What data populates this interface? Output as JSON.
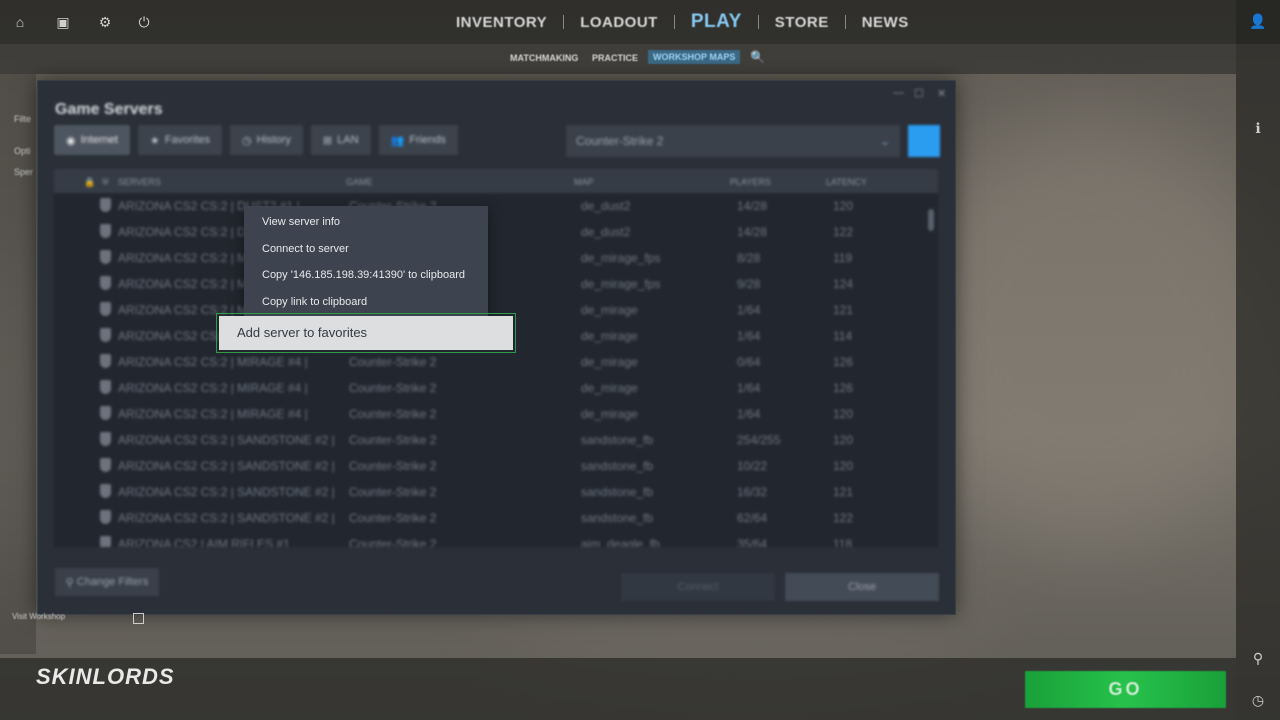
{
  "topnav": {
    "items": [
      "INVENTORY",
      "LOADOUT",
      "PLAY",
      "STORE",
      "NEWS"
    ],
    "active": "PLAY"
  },
  "subnav": {
    "items": [
      "MATCHMAKING",
      "PRACTICE",
      "WORKSHOP MAPS"
    ],
    "active": "WORKSHOP MAPS"
  },
  "left_panel": {
    "line1": "Filte",
    "line2": "Opti",
    "line3": "Sper"
  },
  "dialog": {
    "title": "Game Servers",
    "tabs": [
      "Internet",
      "Favorites",
      "History",
      "LAN",
      "Friends"
    ],
    "game_select": "Counter-Strike 2",
    "columns": [
      "SERVERS",
      "GAME",
      "MAP",
      "PLAYERS",
      "LATENCY"
    ],
    "rows": [
      {
        "server": "ARIZONA CS2 CS:2 | DUST2 #1 |",
        "game": "Counter-Strike 2",
        "map": "de_dust2",
        "players": "14/28",
        "latency": "120"
      },
      {
        "server": "ARIZONA CS2 CS:2 | DUST2 #2 |",
        "game": "Counter-Strike 2",
        "map": "de_dust2",
        "players": "14/28",
        "latency": "122"
      },
      {
        "server": "ARIZONA CS2 CS:2 | MIRAGE #1 |",
        "game": "Counter-Strike 2",
        "map": "de_mirage_fps",
        "players": "8/28",
        "latency": "119"
      },
      {
        "server": "ARIZONA CS2 CS:2 | MIRAGE #2 |",
        "game": "Counter-Strike 2",
        "map": "de_mirage_fps",
        "players": "9/28",
        "latency": "124"
      },
      {
        "server": "ARIZONA CS2 CS:2 | MIRAGE #3 |",
        "game": "Counter-Strike 2",
        "map": "de_mirage",
        "players": "1/64",
        "latency": "121"
      },
      {
        "server": "ARIZONA CS2 CS:2 | MIRAGE #4 |",
        "game": "Counter-Strike 2",
        "map": "de_mirage",
        "players": "1/64",
        "latency": "114"
      },
      {
        "server": "ARIZONA CS2 CS:2 | MIRAGE #4 |",
        "game": "Counter-Strike 2",
        "map": "de_mirage",
        "players": "0/64",
        "latency": "126"
      },
      {
        "server": "ARIZONA CS2 CS:2 | MIRAGE #4 |",
        "game": "Counter-Strike 2",
        "map": "de_mirage",
        "players": "1/64",
        "latency": "126"
      },
      {
        "server": "ARIZONA CS2 CS:2 | MIRAGE #4 |",
        "game": "Counter-Strike 2",
        "map": "de_mirage",
        "players": "1/64",
        "latency": "120"
      },
      {
        "server": "ARIZONA CS2 CS:2 | SANDSTONE #2 |",
        "game": "Counter-Strike 2",
        "map": "sandstone_fb",
        "players": "254/255",
        "latency": "120"
      },
      {
        "server": "ARIZONA CS2 CS:2 | SANDSTONE #2 |",
        "game": "Counter-Strike 2",
        "map": "sandstone_fb",
        "players": "10/22",
        "latency": "120"
      },
      {
        "server": "ARIZONA CS2 CS:2 | SANDSTONE #2 |",
        "game": "Counter-Strike 2",
        "map": "sandstone_fb",
        "players": "16/32",
        "latency": "121"
      },
      {
        "server": "ARIZONA CS2 CS:2 | SANDSTONE #2 |",
        "game": "Counter-Strike 2",
        "map": "sandstone_fb",
        "players": "62/64",
        "latency": "122"
      },
      {
        "server": "ARIZONA CS2 | AIM RIFLES #1",
        "game": "Counter-Strike 2",
        "map": "aim_deagle_fb",
        "players": "35/64",
        "latency": "118"
      }
    ],
    "change_filters": "Change Filters",
    "connect": "Connect",
    "close": "Close"
  },
  "context_menu": {
    "items": [
      "View server info",
      "Connect to server",
      "Copy '146.185.198.39:41390' to clipboard",
      "Copy link to clipboard"
    ],
    "highlighted": "Add server to favorites"
  },
  "workshop_label": "Visit Workshop",
  "logo": "SKINLORDS",
  "go_button": "GO"
}
